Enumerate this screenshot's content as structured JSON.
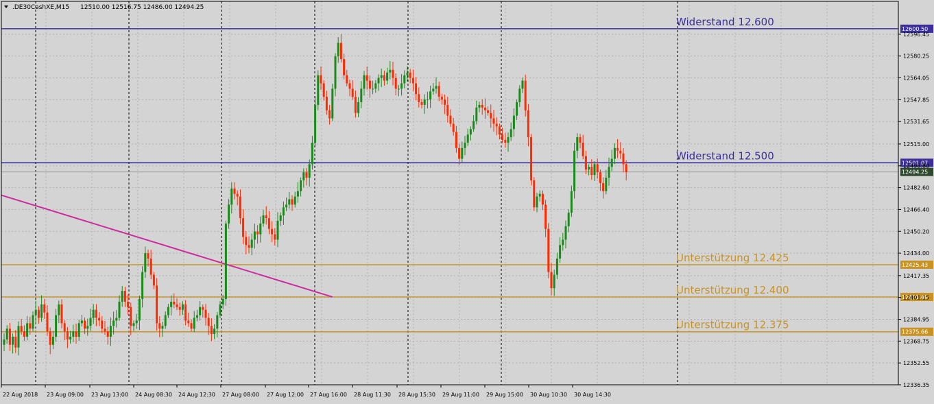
{
  "header": {
    "symbol": ".DE30CashXE,M15",
    "ohlc": "12510.00 12516.75 12486.00 12494.25"
  },
  "colors": {
    "background": "#d4d4d4",
    "grid": "#b0b0b0",
    "bull": "#1a8a1a",
    "bear": "#ff2a00",
    "resistance": "#3a2f9a",
    "support": "#c89322",
    "trendline": "#cc2aa0",
    "axis_text": "#000000"
  },
  "chart_data": {
    "type": "candlestick",
    "timeframe": "M15",
    "symbol": ".DE30CashXE",
    "last_ohlc": {
      "open": 12510.0,
      "high": 12516.75,
      "low": 12486.0,
      "close": 12494.25
    },
    "ylim": [
      12336.35,
      12612.65
    ],
    "y_ticks": [
      "12596.45",
      "12580.25",
      "12564.05",
      "12547.85",
      "12531.65",
      "12515.00",
      "12498.80",
      "12482.60",
      "12466.40",
      "12450.20",
      "12434.00",
      "12417.35",
      "12401.15",
      "12384.95",
      "12368.75",
      "12352.55",
      "12336.35"
    ],
    "x_ticks": [
      "22 Aug 2018",
      "23 Aug 09:00",
      "23 Aug 13:00",
      "24 Aug 08:30",
      "24 Aug 12:30",
      "27 Aug 08:00",
      "27 Aug 12:00",
      "27 Aug 16:00",
      "28 Aug 11:30",
      "28 Aug 15:30",
      "29 Aug 11:00",
      "29 Aug 15:00",
      "30 Aug 10:30",
      "30 Aug 14:30"
    ],
    "session_separators": [
      52,
      188,
      323,
      459,
      595,
      731,
      988
    ],
    "grid": true,
    "levels": [
      {
        "label": "Widerstand 12.600",
        "price": 12600.5,
        "price_label": "12600.50",
        "kind": "resistance"
      },
      {
        "label": "Widerstand 12.500",
        "price": 12501.07,
        "price_label": "12501.07",
        "kind": "resistance"
      },
      {
        "label": "Unterstützung 12.425",
        "price": 12425.43,
        "price_label": "12425.43",
        "kind": "support"
      },
      {
        "label": "Unterstützung 12.400",
        "price": 12401.49,
        "price_label": "12401.49",
        "kind": "support"
      },
      {
        "label": "Unterstützung 12.375",
        "price": 12375.66,
        "price_label": "12375.66",
        "kind": "support"
      }
    ],
    "current_price": {
      "price": 12494.25,
      "label": "12494.25"
    },
    "trendline": {
      "from": {
        "bar": 0,
        "price": 12477.0
      },
      "to": {
        "bar": 114,
        "price": 12401.5
      }
    },
    "bar_count": 217,
    "closes": [
      12370,
      12378,
      12366,
      12372,
      12364,
      12380,
      12376,
      12372,
      12382,
      12378,
      12388,
      12392,
      12386,
      12396,
      12390,
      12376,
      12366,
      12372,
      12388,
      12396,
      12382,
      12376,
      12370,
      12372,
      12376,
      12372,
      12382,
      12384,
      12378,
      12380,
      12386,
      12392,
      12386,
      12384,
      12378,
      12376,
      12372,
      12380,
      12384,
      12386,
      12398,
      12406,
      12398,
      12394,
      12380,
      12382,
      12384,
      12400,
      12420,
      12434,
      12430,
      12418,
      12410,
      12382,
      12378,
      12380,
      12388,
      12394,
      12398,
      12396,
      12394,
      12392,
      12396,
      12384,
      12382,
      12378,
      12386,
      12388,
      12394,
      12392,
      12386,
      12380,
      12374,
      12378,
      12388,
      12396,
      12400,
      12456,
      12470,
      12482,
      12478,
      12476,
      12460,
      12446,
      12440,
      12438,
      12444,
      12450,
      12448,
      12456,
      12462,
      12460,
      12452,
      12448,
      12444,
      12458,
      12462,
      12468,
      12470,
      12474,
      12470,
      12476,
      12480,
      12488,
      12494,
      12490,
      12500,
      12516,
      12544,
      12566,
      12560,
      12550,
      12540,
      12534,
      12556,
      12580,
      12590,
      12578,
      12566,
      12560,
      12556,
      12550,
      12538,
      12546,
      12556,
      12566,
      12562,
      12556,
      12556,
      12560,
      12564,
      12566,
      12562,
      12568,
      12570,
      12564,
      12556,
      12556,
      12560,
      12566,
      12568,
      12564,
      12560,
      12552,
      12546,
      12544,
      12548,
      12548,
      12554,
      12556,
      12558,
      12550,
      12548,
      12544,
      12536,
      12530,
      12524,
      12512,
      12504,
      12512,
      12516,
      12522,
      12526,
      12532,
      12542,
      12544,
      12542,
      12540,
      12538,
      12534,
      12530,
      12528,
      12522,
      12518,
      12516,
      12520,
      12526,
      12536,
      12546,
      12556,
      12562,
      12540,
      12520,
      12488,
      12468,
      12476,
      12478,
      12470,
      12452,
      12420,
      12408,
      12418,
      12430,
      12440,
      12444,
      12454,
      12464,
      12480,
      12510,
      12520,
      12516,
      12506,
      12496,
      12498,
      12492,
      12500,
      12494,
      12486,
      12480,
      12490,
      12498,
      12504,
      12512,
      12510,
      12508,
      12500,
      12494
    ]
  }
}
